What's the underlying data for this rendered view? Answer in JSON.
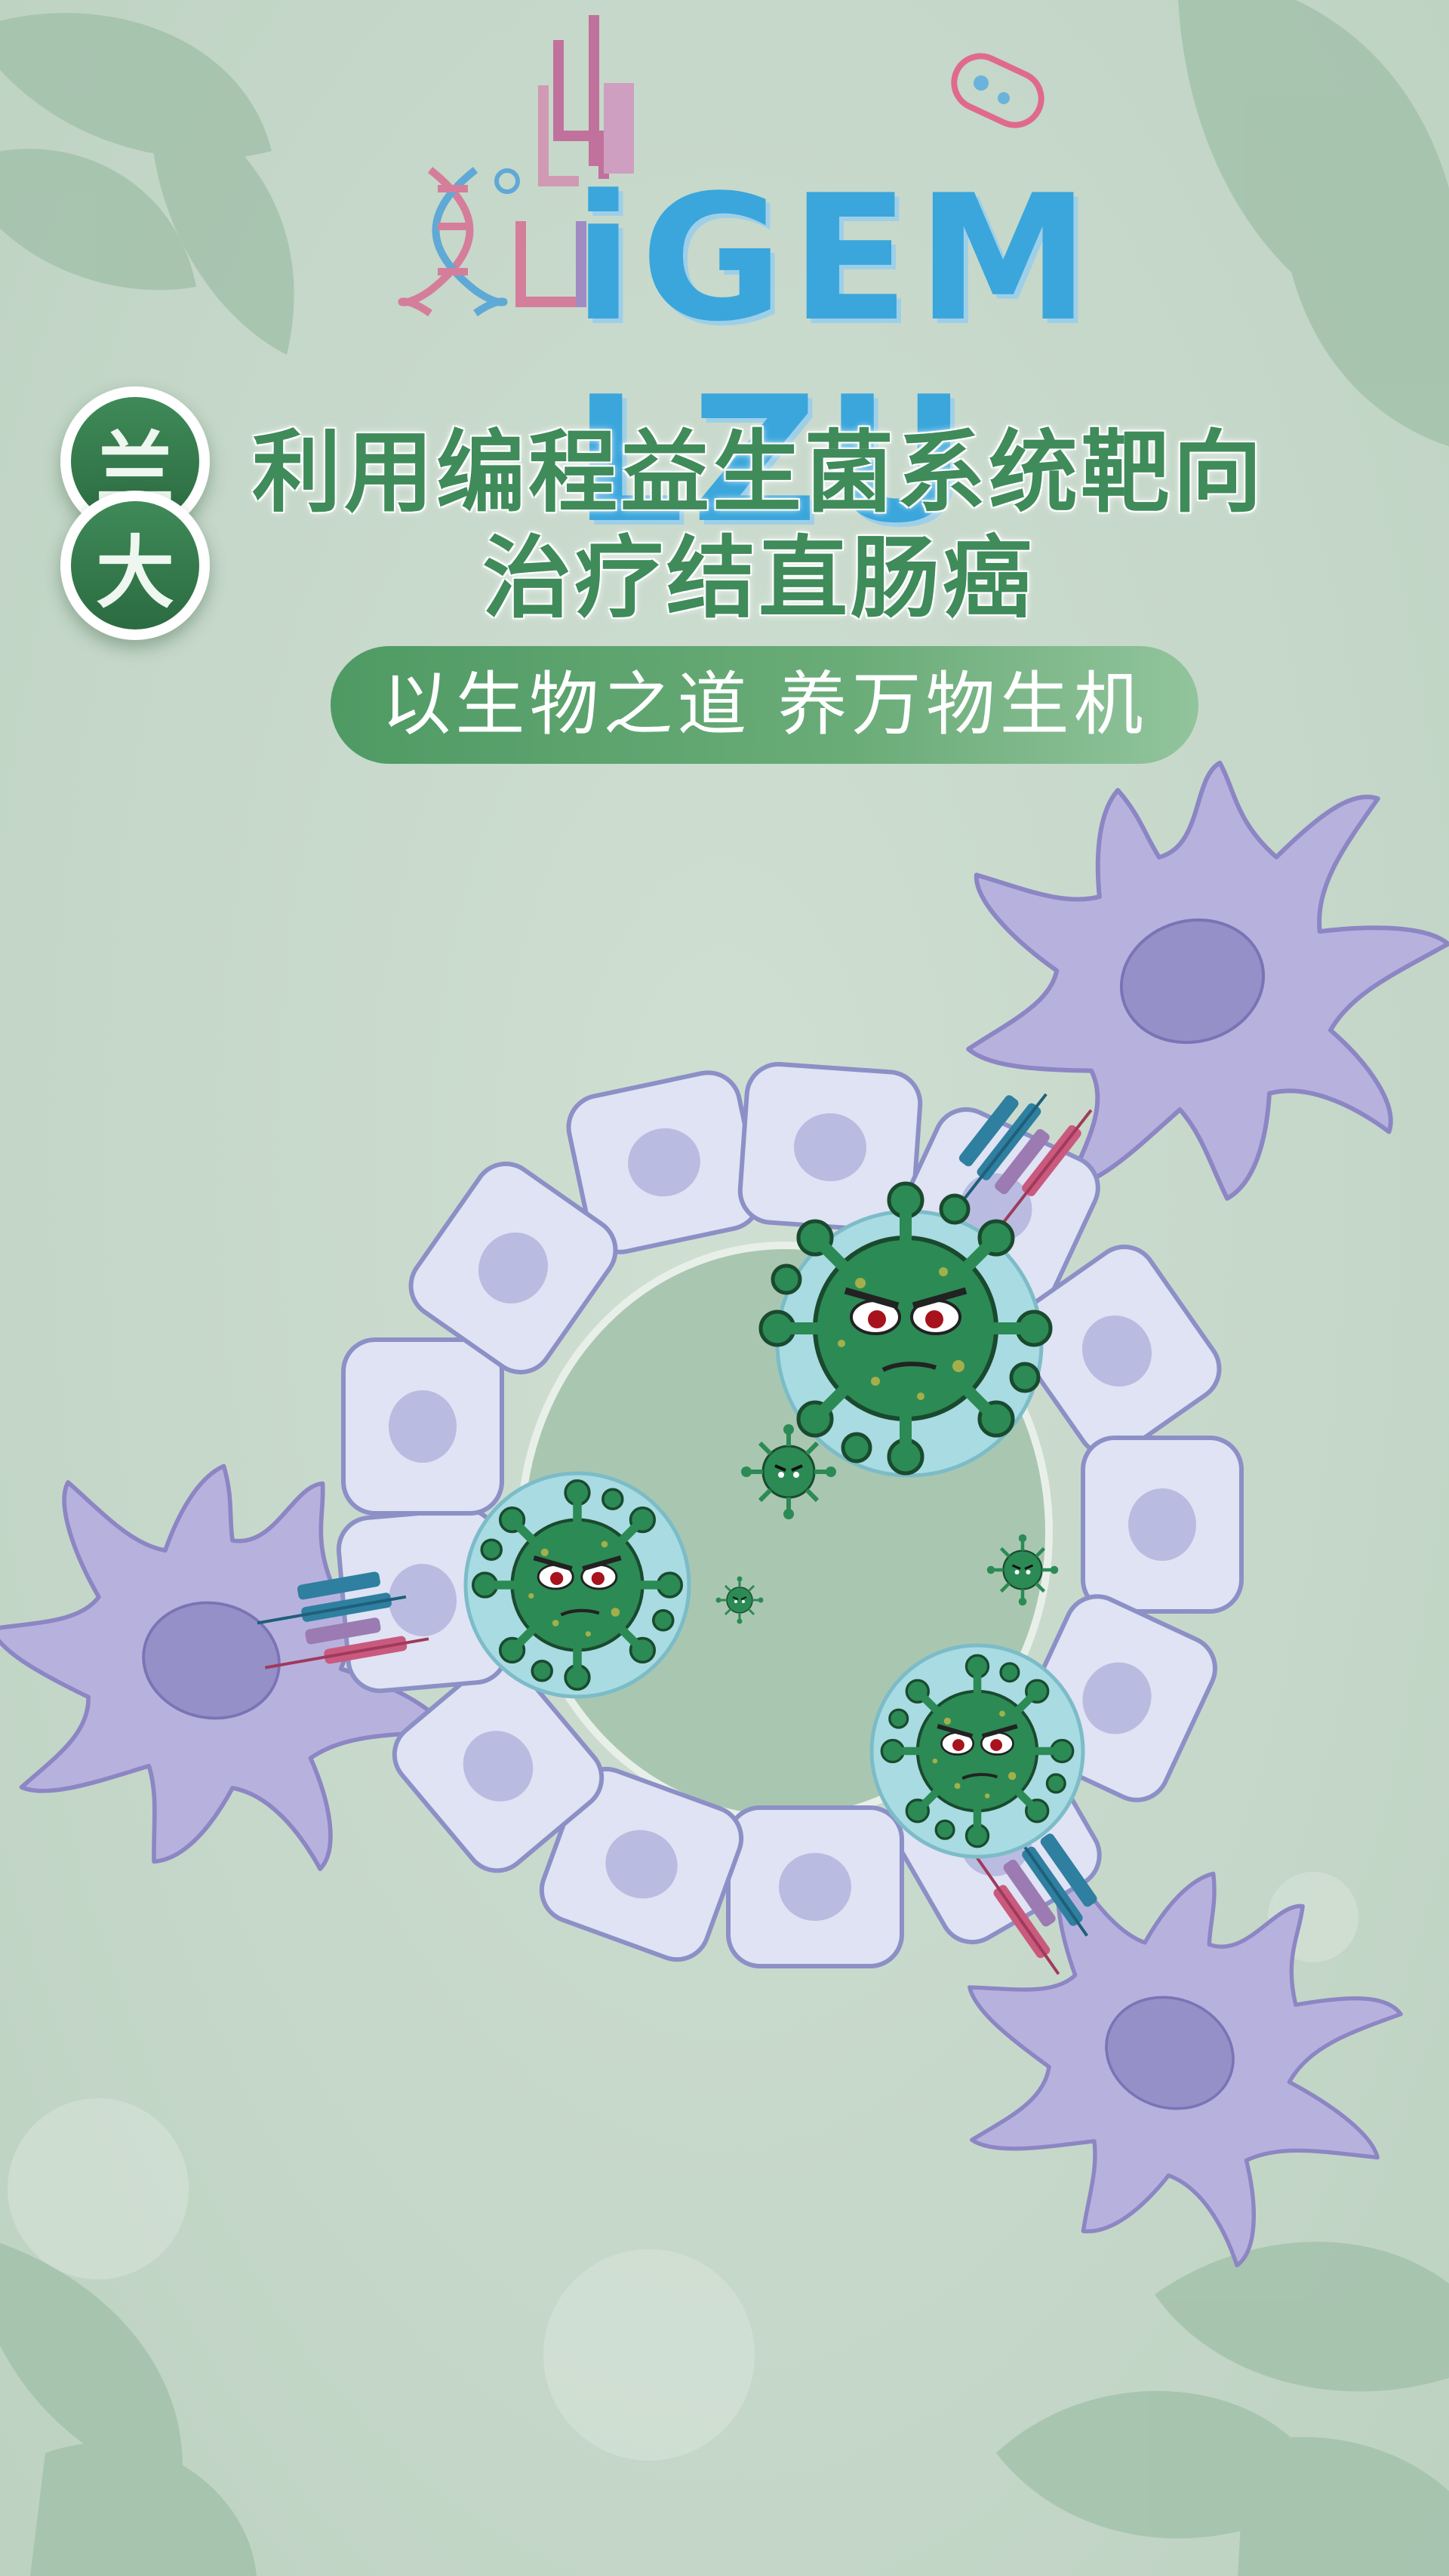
{
  "logo": {
    "text": "iGEM LZU",
    "image_label": "iGEM LZU"
  },
  "badge": {
    "char1": "兰",
    "char2": "大"
  },
  "title": {
    "line1": "利用编程益生菌系统靶向",
    "line2": "治疗结直肠癌"
  },
  "slogan": "以生物之道 养万物生机",
  "colors": {
    "background": "#c8d9cb",
    "title_green": "#3f8b5a",
    "badge_green": "#2b6b41",
    "cell_fill": "#dfe3f3",
    "cell_stroke": "#8c90c6",
    "immune_cell": "#b7b2dd",
    "virus_green": "#2c8a55",
    "bubble": "#a9dbe2"
  },
  "icons": [
    "dna-icon",
    "bacteria-icon",
    "leaf-icon",
    "virus-icon",
    "immune-cell-icon",
    "antibody-icon"
  ]
}
